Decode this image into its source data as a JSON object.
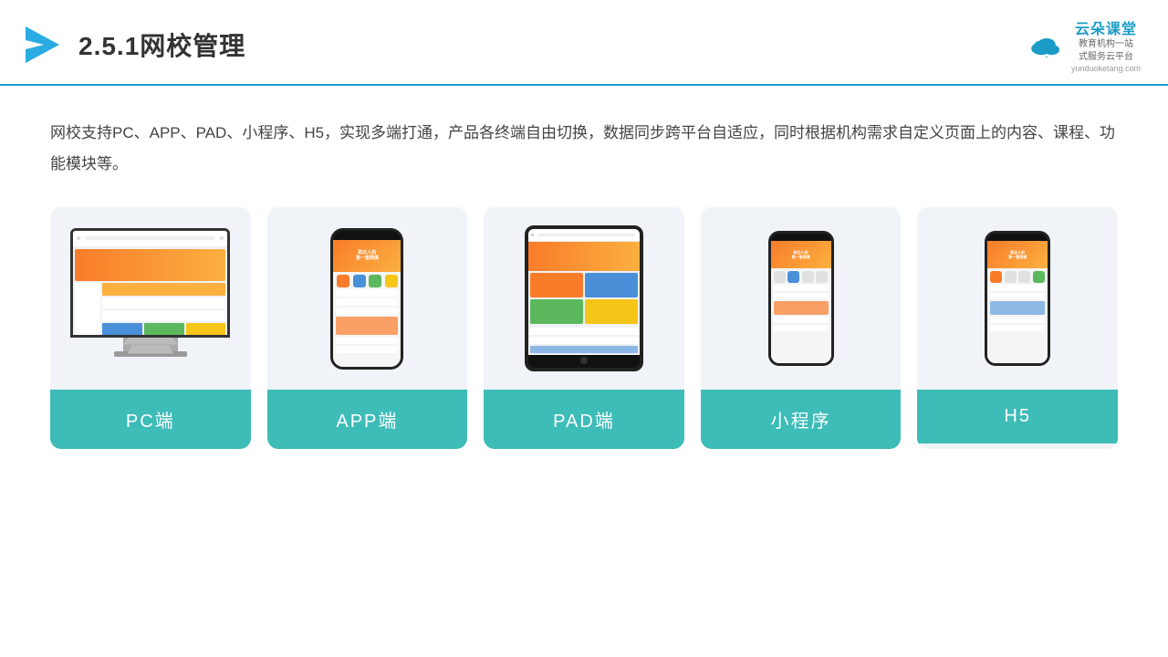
{
  "header": {
    "title": "2.5.1网校管理",
    "brand_name": "云朵课堂",
    "brand_sub_line1": "教育机构一站",
    "brand_sub_line2": "式服务云平台",
    "brand_url": "yunduoketang.com"
  },
  "description": {
    "text": "网校支持PC、APP、PAD、小程序、H5，实现多端打通，产品各终端自由切换，数据同步跨平台自适应，同时根据机构需求自定义页面上的内容、课程、功能模块等。"
  },
  "cards": [
    {
      "id": "pc",
      "label": "PC端"
    },
    {
      "id": "app",
      "label": "APP端"
    },
    {
      "id": "pad",
      "label": "PAD端"
    },
    {
      "id": "miniprogram",
      "label": "小程序"
    },
    {
      "id": "h5",
      "label": "H5"
    }
  ],
  "colors": {
    "accent": "#3dbcb8",
    "header_border": "#1a9cc6",
    "brand": "#1a9cc6",
    "arrow": "#2aabe2"
  }
}
